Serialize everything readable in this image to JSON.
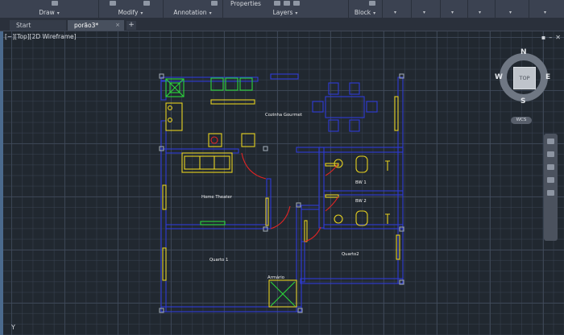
{
  "ribbon": {
    "panels": [
      {
        "label": "Draw"
      },
      {
        "label": "Modify"
      },
      {
        "label": "Annotation"
      },
      {
        "label": "Layers"
      },
      {
        "label": "Block"
      }
    ],
    "properties_label": "Properties"
  },
  "tabs": {
    "start_label": "Start",
    "active_label": "porão3*",
    "close_glyph": "×",
    "add_glyph": "+"
  },
  "viewport": {
    "label": "[−][Top][2D Wireframe]",
    "controls": [
      "▪",
      "–",
      "✕"
    ]
  },
  "viewcube": {
    "top": "TOP",
    "north": "N",
    "south": "S",
    "east": "E",
    "west": "W",
    "wcs": "WCS"
  },
  "plan": {
    "rooms": [
      {
        "name": "Cozinha Gourmet"
      },
      {
        "name": "Home Theater"
      },
      {
        "name": "BW 1"
      },
      {
        "name": "BW 2"
      },
      {
        "name": "Quarto 1"
      },
      {
        "name": "Quarto2"
      },
      {
        "name": "Armário"
      }
    ],
    "colors": {
      "wall": "#2f3bd6",
      "furniture": "#e6d11f",
      "fixture": "#2bd63a",
      "door": "#e02424"
    }
  },
  "ucs_label": "Y"
}
